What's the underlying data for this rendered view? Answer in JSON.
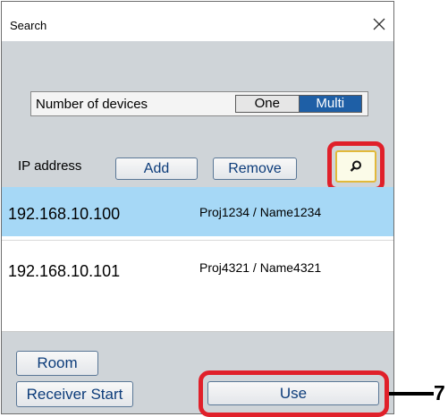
{
  "window": {
    "title": "Search"
  },
  "devices": {
    "label": "Number of devices",
    "options": [
      "One",
      "Multi"
    ],
    "selected": "Multi"
  },
  "ip": {
    "label": "IP address",
    "add_label": "Add",
    "remove_label": "Remove"
  },
  "list": {
    "rows": [
      {
        "ip": "192.168.10.100",
        "name": "Proj1234 / Name1234",
        "selected": true
      },
      {
        "ip": "192.168.10.101",
        "name": "Proj4321 / Name4321",
        "selected": false
      }
    ]
  },
  "buttons": {
    "room": "Room",
    "receiver_start": "Receiver Start",
    "use": "Use"
  },
  "callout": {
    "number": "7"
  },
  "icons": {
    "close": "close-icon",
    "search": "magnifier-icon"
  },
  "colors": {
    "highlight": "#e0202a",
    "selected_row": "#a6d8f6",
    "toggle_active": "#1e5fa6",
    "panel": "#cfd4d8"
  }
}
